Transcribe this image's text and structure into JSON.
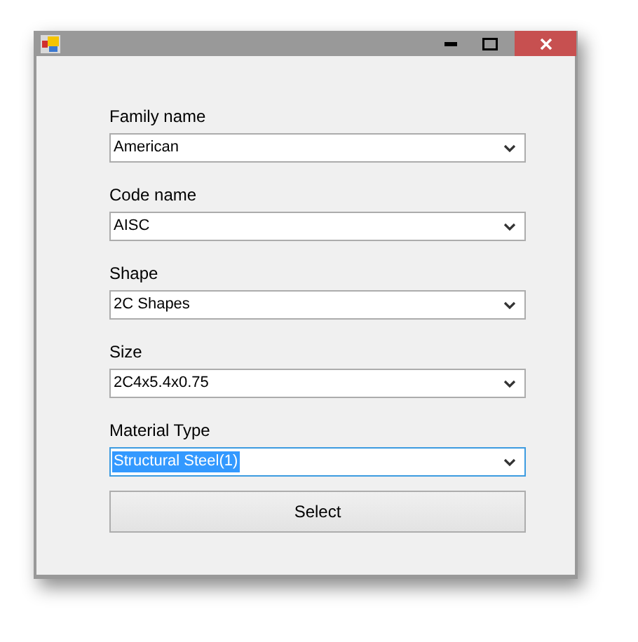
{
  "window": {
    "title_buttons": [
      {
        "kind": "minimize"
      },
      {
        "kind": "maximize"
      },
      {
        "kind": "close"
      }
    ]
  },
  "fields": [
    {
      "label": "Family name",
      "value": "American",
      "focused": false
    },
    {
      "label": "Code name",
      "value": "AISC",
      "focused": false
    },
    {
      "label": "Shape",
      "value": "2C Shapes",
      "focused": false
    },
    {
      "label": "Size",
      "value": "2C4x5.4x0.75",
      "focused": false
    },
    {
      "label": "Material Type",
      "value": "Structural Steel(1)",
      "focused": true
    }
  ],
  "button": "Select"
}
